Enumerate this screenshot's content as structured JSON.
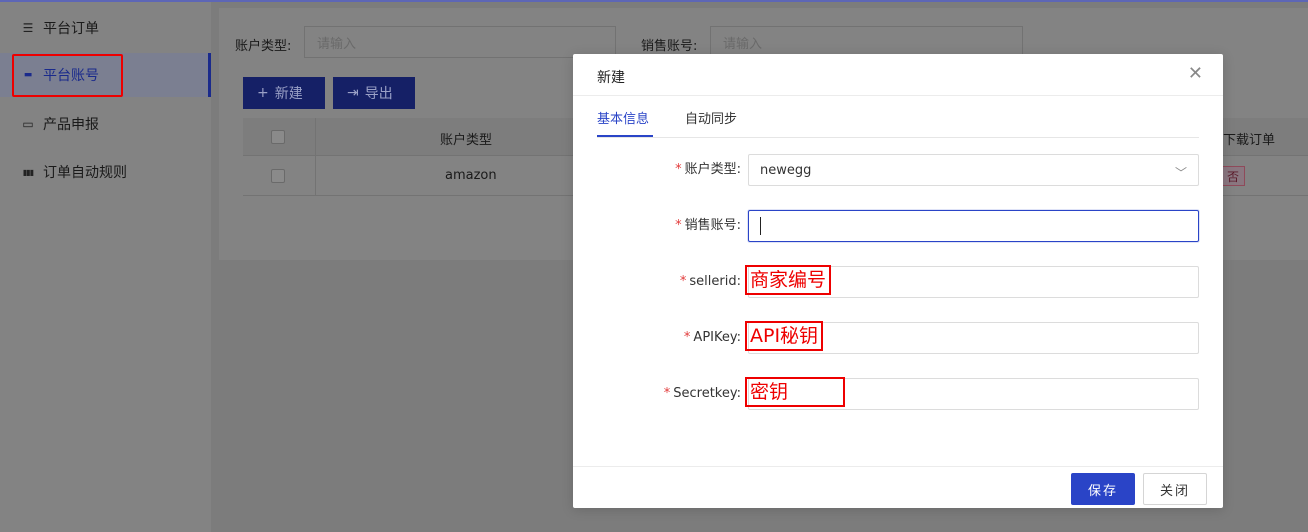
{
  "sidebar": {
    "items": [
      {
        "label": "平台订单",
        "icon": "menu-icon",
        "glyph": "☰"
      },
      {
        "label": "平台账号",
        "icon": "card-icon",
        "glyph": "▬"
      },
      {
        "label": "产品申报",
        "icon": "monitor-icon",
        "glyph": "▭"
      },
      {
        "label": "订单自动规则",
        "icon": "bar-chart-icon",
        "glyph": "▮▮▮"
      }
    ],
    "active_index": 1
  },
  "filters": {
    "account_type_label": "账户类型:",
    "account_type_placeholder": "请输入",
    "sales_account_label": "销售账号:",
    "sales_account_placeholder": "请输入"
  },
  "toolbar": {
    "new_label": "新建",
    "new_icon": "+",
    "export_label": "导出",
    "export_icon": "⇥"
  },
  "table": {
    "headers": {
      "account_type": "账户类型",
      "download_orders": "下载订单"
    },
    "rows": [
      {
        "account_type": "amazon",
        "download_orders": "否"
      }
    ]
  },
  "modal": {
    "title": "新建",
    "close_glyph": "✕",
    "tabs": [
      {
        "label": "基本信息",
        "active": true
      },
      {
        "label": "自动同步",
        "active": false
      }
    ],
    "fields": {
      "account_type": {
        "label": "账户类型:",
        "value": "newegg"
      },
      "sales_account": {
        "label": "销售账号:",
        "value": ""
      },
      "sellerid": {
        "label": "sellerid:",
        "value": ""
      },
      "apikey": {
        "label": "APIKey:",
        "value": ""
      },
      "secretkey": {
        "label": "Secretkey:",
        "value": ""
      }
    },
    "required_mark": "*",
    "select_arrow": "﹀",
    "annotations": {
      "sellerid": "商家编号",
      "apikey": "API秘钥",
      "secretkey": "密钥"
    },
    "footer": {
      "save_label": "保存",
      "close_label": "关闭"
    }
  },
  "colors": {
    "accent": "#2a44c7",
    "required": "#e23a3a",
    "annotation": "#ee0000"
  }
}
